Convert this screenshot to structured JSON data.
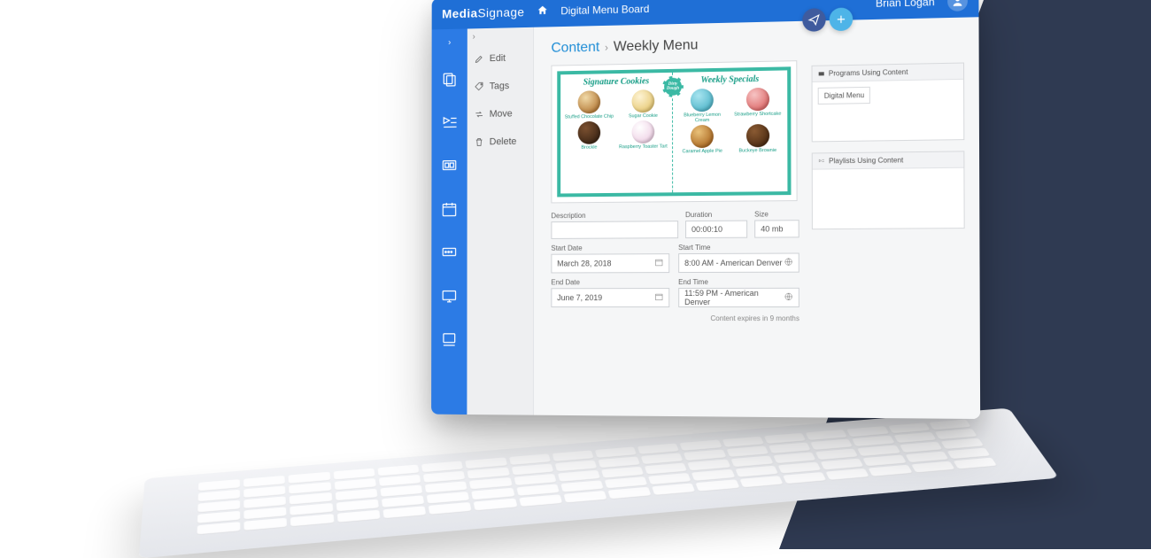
{
  "header": {
    "logo_prefix": "Media",
    "logo_suffix": "Signage",
    "app_title": "Digital Menu Board",
    "user_name": "Brian Logan"
  },
  "subnav": {
    "items": [
      {
        "label": "Edit",
        "icon": "pencil-icon"
      },
      {
        "label": "Tags",
        "icon": "tag-icon"
      },
      {
        "label": "Move",
        "icon": "swap-icon"
      },
      {
        "label": "Delete",
        "icon": "trash-icon"
      }
    ]
  },
  "breadcrumb": {
    "root": "Content",
    "leaf": "Weekly Menu"
  },
  "menu_preview": {
    "brand": "Dirty Dough",
    "left_heading": "Signature Cookies",
    "right_heading": "Weekly Specials",
    "left_items": [
      {
        "name": "Stuffed Chocolate Chip",
        "style": "choc"
      },
      {
        "name": "Sugar Cookie",
        "style": "sugar"
      },
      {
        "name": "Brockle",
        "style": "dark"
      },
      {
        "name": "Raspberry Toaster Tart",
        "style": "rasp"
      }
    ],
    "right_items": [
      {
        "name": "Blueberry Lemon Cream",
        "style": "blue"
      },
      {
        "name": "Strawberry Shortcake",
        "style": "straw"
      },
      {
        "name": "Caramel Apple Pie",
        "style": "caramel"
      },
      {
        "name": "Buckeye Brownie",
        "style": "buck"
      }
    ]
  },
  "details": {
    "description_label": "Description",
    "description_value": "",
    "duration_label": "Duration",
    "duration_value": "00:00:10",
    "size_label": "Size",
    "size_value": "40 mb",
    "start_date_label": "Start Date",
    "start_date_value": "March 28, 2018",
    "end_date_label": "End Date",
    "end_date_value": "June 7, 2019",
    "start_time_label": "Start Time",
    "start_time_value": "8:00 AM - American Denver",
    "end_time_label": "End Time",
    "end_time_value": "11:59 PM - American Denver",
    "expires_note": "Content expires in 9 months"
  },
  "right_panels": {
    "programs_heading": "Programs Using Content",
    "programs_item": "Digital Menu",
    "playlists_heading": "Playlists Using Content"
  }
}
